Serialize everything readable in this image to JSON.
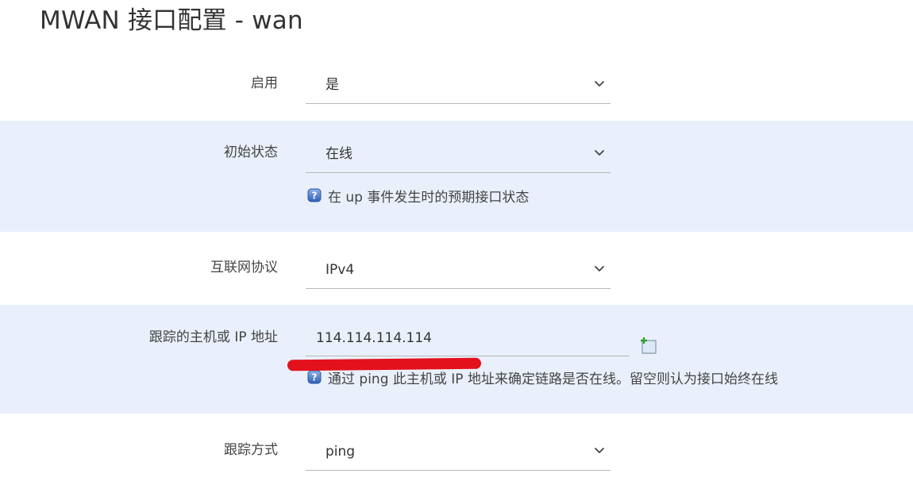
{
  "page": {
    "title": "MWAN 接口配置 - wan"
  },
  "form": {
    "enabled": {
      "label": "启用",
      "value": "是"
    },
    "initial_state": {
      "label": "初始状态",
      "value": "在线",
      "help": "在 up 事件发生时的预期接口状态"
    },
    "protocol": {
      "label": "互联网协议",
      "value": "IPv4"
    },
    "track_ip": {
      "label": "跟踪的主机或 IP 地址",
      "value": "114.114.114.114",
      "help": "通过 ping 此主机或 IP 地址来确定链路是否在线。留空则认为接口始终在线"
    },
    "track_method": {
      "label": "跟踪方式",
      "value": "ping"
    }
  },
  "icons": {
    "chevron": "chevron-down-icon",
    "help": "help-icon",
    "add": "add-field-icon"
  },
  "colors": {
    "alt_row_bg": "#e9f0fb",
    "annotation_red": "#e3111c",
    "help_icon_blue": "#3a6fc4"
  }
}
